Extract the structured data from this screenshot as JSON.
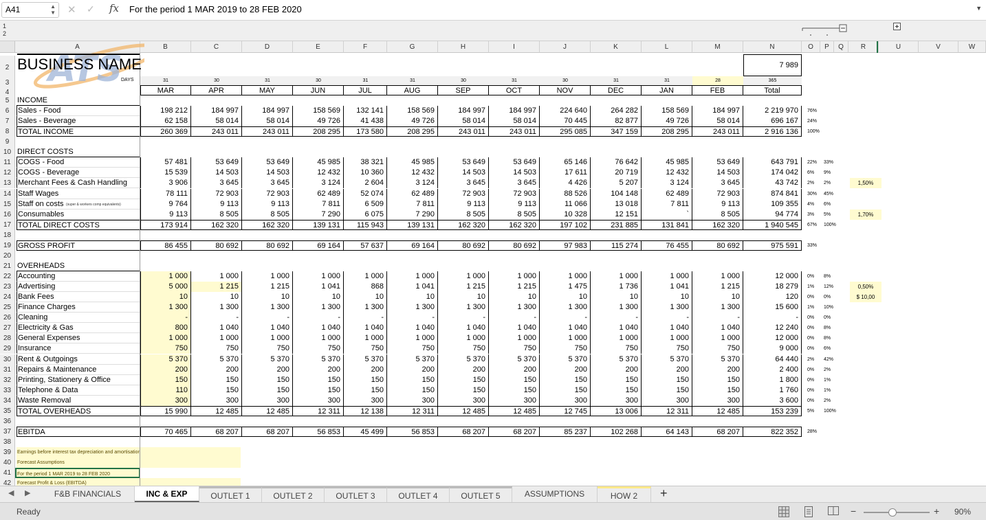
{
  "formula_bar": {
    "name_box": "A41",
    "formula": "For the period 1 MAR 2019 to 28 FEB 2020"
  },
  "outline_levels": [
    "1",
    "2"
  ],
  "columns": [
    "A",
    "B",
    "C",
    "D",
    "E",
    "F",
    "G",
    "H",
    "I",
    "J",
    "K",
    "L",
    "M",
    "N",
    "O",
    "P",
    "Q",
    "R",
    "U",
    "V",
    "W"
  ],
  "business_name": "BUSINESS NAME",
  "logo_text": "ATS",
  "days_label": "DAYS",
  "n2_value": "7 989",
  "days": [
    "31",
    "30",
    "31",
    "30",
    "31",
    "31",
    "30",
    "31",
    "30",
    "31",
    "31",
    "28",
    "365"
  ],
  "months": [
    "MAR",
    "APR",
    "MAY",
    "JUN",
    "JUL",
    "AUG",
    "SEP",
    "OCT",
    "NOV",
    "DEC",
    "JAN",
    "FEB",
    "Total"
  ],
  "rows": [
    {
      "r": "5",
      "label": "INCOME",
      "vals": [],
      "o": "",
      "p": "",
      "s": ""
    },
    {
      "r": "6",
      "label": "Sales - Food",
      "vals": [
        "198 212",
        "184 997",
        "184 997",
        "158 569",
        "132 141",
        "158 569",
        "184 997",
        "184 997",
        "224 640",
        "264 282",
        "158 569",
        "184 997",
        "2 219 970"
      ],
      "o": "76%",
      "p": "",
      "s": ""
    },
    {
      "r": "7",
      "label": "Sales - Beverage",
      "vals": [
        "62 158",
        "58 014",
        "58 014",
        "49 726",
        "41 438",
        "49 726",
        "58 014",
        "58 014",
        "70 445",
        "82 877",
        "49 726",
        "58 014",
        "696 167"
      ],
      "o": "24%",
      "p": "",
      "s": ""
    },
    {
      "r": "8",
      "label": "TOTAL INCOME",
      "vals": [
        "260 369",
        "243 011",
        "243 011",
        "208 295",
        "173 580",
        "208 295",
        "243 011",
        "243 011",
        "295 085",
        "347 159",
        "208 295",
        "243 011",
        "2 916 136"
      ],
      "o": "100%",
      "p": "",
      "s": ""
    },
    {
      "r": "9",
      "label": "",
      "vals": [],
      "o": "",
      "p": "",
      "s": ""
    },
    {
      "r": "10",
      "label": "DIRECT COSTS",
      "vals": [],
      "o": "",
      "p": "",
      "s": ""
    },
    {
      "r": "11",
      "label": "COGS - Food",
      "vals": [
        "57 481",
        "53 649",
        "53 649",
        "45 985",
        "38 321",
        "45 985",
        "53 649",
        "53 649",
        "65 146",
        "76 642",
        "45 985",
        "53 649",
        "643 791"
      ],
      "o": "22%",
      "p": "33%",
      "s": ""
    },
    {
      "r": "12",
      "label": "COGS - Beverage",
      "vals": [
        "15 539",
        "14 503",
        "14 503",
        "12 432",
        "10 360",
        "12 432",
        "14 503",
        "14 503",
        "17 611",
        "20 719",
        "12 432",
        "14 503",
        "174 042"
      ],
      "o": "6%",
      "p": "9%",
      "s": ""
    },
    {
      "r": "13",
      "label": "Merchant Fees & Cash Handling",
      "vals": [
        "3 906",
        "3 645",
        "3 645",
        "3 124",
        "2 604",
        "3 124",
        "3 645",
        "3 645",
        "4 426",
        "5 207",
        "3 124",
        "3 645",
        "43 742"
      ],
      "o": "2%",
      "p": "2%",
      "s": "1,50%"
    },
    {
      "r": "14",
      "label": "Staff Wages",
      "vals": [
        "78 111",
        "72 903",
        "72 903",
        "62 489",
        "52 074",
        "62 489",
        "72 903",
        "72 903",
        "88 526",
        "104 148",
        "62 489",
        "72 903",
        "874 841"
      ],
      "o": "30%",
      "p": "45%",
      "s": ""
    },
    {
      "r": "15",
      "label": "Staff on costs",
      "sub": "(super & workers comp equivalents)",
      "vals": [
        "9 764",
        "9 113",
        "9 113",
        "7 811",
        "6 509",
        "7 811",
        "9 113",
        "9 113",
        "11 066",
        "13 018",
        "7 811",
        "9 113",
        "109 355"
      ],
      "o": "4%",
      "p": "6%",
      "s": ""
    },
    {
      "r": "16",
      "label": "Consumables",
      "vals": [
        "9 113",
        "8 505",
        "8 505",
        "7 290",
        "6 075",
        "7 290",
        "8 505",
        "8 505",
        "10 328",
        "12 151",
        "`",
        "8 505",
        "94 774"
      ],
      "o": "3%",
      "p": "5%",
      "s": "1,70%"
    },
    {
      "r": "17",
      "label": "TOTAL DIRECT COSTS",
      "vals": [
        "173 914",
        "162 320",
        "162 320",
        "139 131",
        "115 943",
        "139 131",
        "162 320",
        "162 320",
        "197 102",
        "231 885",
        "131 841",
        "162 320",
        "1 940 545"
      ],
      "o": "67%",
      "p": "100%",
      "s": ""
    },
    {
      "r": "18",
      "label": "",
      "vals": [],
      "o": "",
      "p": "",
      "s": ""
    },
    {
      "r": "19",
      "label": "GROSS PROFIT",
      "vals": [
        "86 455",
        "80 692",
        "80 692",
        "69 164",
        "57 637",
        "69 164",
        "80 692",
        "80 692",
        "97 983",
        "115 274",
        "76 455",
        "80 692",
        "975 591"
      ],
      "o": "33%",
      "p": "",
      "s": ""
    },
    {
      "r": "20",
      "label": "",
      "vals": [],
      "o": "",
      "p": "",
      "s": ""
    },
    {
      "r": "21",
      "label": "OVERHEADS",
      "vals": [],
      "o": "",
      "p": "",
      "s": ""
    },
    {
      "r": "22",
      "label": "Accounting",
      "vals": [
        "1 000",
        "1 000",
        "1 000",
        "1 000",
        "1 000",
        "1 000",
        "1 000",
        "1 000",
        "1 000",
        "1 000",
        "1 000",
        "1 000",
        "12 000"
      ],
      "o": "0%",
      "p": "8%",
      "s": ""
    },
    {
      "r": "23",
      "label": "Advertising",
      "vals": [
        "5 000",
        "1 215",
        "1 215",
        "1 041",
        "868",
        "1 041",
        "1 215",
        "1 215",
        "1 475",
        "1 736",
        "1 041",
        "1 215",
        "18 279"
      ],
      "o": "1%",
      "p": "12%",
      "s": "0,50%"
    },
    {
      "r": "24",
      "label": "Bank Fees",
      "vals": [
        "10",
        "10",
        "10",
        "10",
        "10",
        "10",
        "10",
        "10",
        "10",
        "10",
        "10",
        "10",
        "120"
      ],
      "o": "0%",
      "p": "0%",
      "s": "$ 10,00"
    },
    {
      "r": "25",
      "label": "Finance Charges",
      "vals": [
        "1 300",
        "1 300",
        "1 300",
        "1 300",
        "1 300",
        "1 300",
        "1 300",
        "1 300",
        "1 300",
        "1 300",
        "1 300",
        "1 300",
        "15 600"
      ],
      "o": "1%",
      "p": "10%",
      "s": ""
    },
    {
      "r": "26",
      "label": "Cleaning",
      "vals": [
        "-",
        "-",
        "-",
        "-",
        "-",
        "-",
        "-",
        "-",
        "-",
        "-",
        "-",
        "-",
        "-"
      ],
      "o": "0%",
      "p": "0%",
      "s": ""
    },
    {
      "r": "27",
      "label": "Electricity & Gas",
      "vals": [
        "800",
        "1 040",
        "1 040",
        "1 040",
        "1 040",
        "1 040",
        "1 040",
        "1 040",
        "1 040",
        "1 040",
        "1 040",
        "1 040",
        "12 240"
      ],
      "o": "0%",
      "p": "8%",
      "s": ""
    },
    {
      "r": "28",
      "label": "General Expenses",
      "vals": [
        "1 000",
        "1 000",
        "1 000",
        "1 000",
        "1 000",
        "1 000",
        "1 000",
        "1 000",
        "1 000",
        "1 000",
        "1 000",
        "1 000",
        "12 000"
      ],
      "o": "0%",
      "p": "8%",
      "s": ""
    },
    {
      "r": "29",
      "label": "Insurance",
      "vals": [
        "750",
        "750",
        "750",
        "750",
        "750",
        "750",
        "750",
        "750",
        "750",
        "750",
        "750",
        "750",
        "9 000"
      ],
      "o": "0%",
      "p": "6%",
      "s": ""
    },
    {
      "r": "30",
      "label": "Rent & Outgoings",
      "vals": [
        "5 370",
        "5 370",
        "5 370",
        "5 370",
        "5 370",
        "5 370",
        "5 370",
        "5 370",
        "5 370",
        "5 370",
        "5 370",
        "5 370",
        "64 440"
      ],
      "o": "2%",
      "p": "42%",
      "s": ""
    },
    {
      "r": "31",
      "label": "Repairs & Maintenance",
      "vals": [
        "200",
        "200",
        "200",
        "200",
        "200",
        "200",
        "200",
        "200",
        "200",
        "200",
        "200",
        "200",
        "2 400"
      ],
      "o": "0%",
      "p": "2%",
      "s": ""
    },
    {
      "r": "32",
      "label": "Printing, Stationery & Office",
      "vals": [
        "150",
        "150",
        "150",
        "150",
        "150",
        "150",
        "150",
        "150",
        "150",
        "150",
        "150",
        "150",
        "1 800"
      ],
      "o": "0%",
      "p": "1%",
      "s": ""
    },
    {
      "r": "33",
      "label": "Telephone & Data",
      "vals": [
        "110",
        "150",
        "150",
        "150",
        "150",
        "150",
        "150",
        "150",
        "150",
        "150",
        "150",
        "150",
        "1 760"
      ],
      "o": "0%",
      "p": "1%",
      "s": ""
    },
    {
      "r": "34",
      "label": "Waste Removal",
      "vals": [
        "300",
        "300",
        "300",
        "300",
        "300",
        "300",
        "300",
        "300",
        "300",
        "300",
        "300",
        "300",
        "3 600"
      ],
      "o": "0%",
      "p": "2%",
      "s": ""
    },
    {
      "r": "35",
      "label": "TOTAL OVERHEADS",
      "vals": [
        "15 990",
        "12 485",
        "12 485",
        "12 311",
        "12 138",
        "12 311",
        "12 485",
        "12 485",
        "12 745",
        "13 006",
        "12 311",
        "12 485",
        "153 239"
      ],
      "o": "5%",
      "p": "100%",
      "s": ""
    },
    {
      "r": "36",
      "label": "",
      "vals": [],
      "o": "",
      "p": "",
      "s": ""
    },
    {
      "r": "37",
      "label": "EBITDA",
      "vals": [
        "70 465",
        "68 207",
        "68 207",
        "56 853",
        "45 499",
        "56 853",
        "68 207",
        "68 207",
        "85 237",
        "102 268",
        "64 143",
        "68 207",
        "822 352"
      ],
      "o": "28%",
      "p": "",
      "s": ""
    },
    {
      "r": "38",
      "label": "",
      "vals": [],
      "o": "",
      "p": "",
      "s": ""
    },
    {
      "r": "39",
      "label": "Earnings before interest tax depreciation and amortisation",
      "vals": [],
      "o": "",
      "p": "",
      "s": "",
      "note": true
    },
    {
      "r": "40",
      "label": "Forecast Assumptions",
      "vals": [],
      "o": "",
      "p": "",
      "s": "",
      "note": true
    },
    {
      "r": "41",
      "label": "For the period 1 MAR 2019 to 28 FEB 2020",
      "vals": [],
      "o": "",
      "p": "",
      "s": "",
      "note": true
    },
    {
      "r": "42",
      "label": "Forecast Profit & Loss (EBITDA)",
      "vals": [],
      "o": "",
      "p": "",
      "s": "",
      "note": true
    }
  ],
  "row_labels_top": [
    "2",
    "3",
    "4"
  ],
  "tabs": [
    "F&B FINANCIALS",
    "INC & EXP",
    "OUTLET 1",
    "OUTLET 2",
    "OUTLET 3",
    "OUTLET 4",
    "OUTLET 5",
    "ASSUMPTIONS",
    "HOW 2"
  ],
  "active_tab": "INC & EXP",
  "status": {
    "text": "Ready",
    "zoom": "90%"
  }
}
